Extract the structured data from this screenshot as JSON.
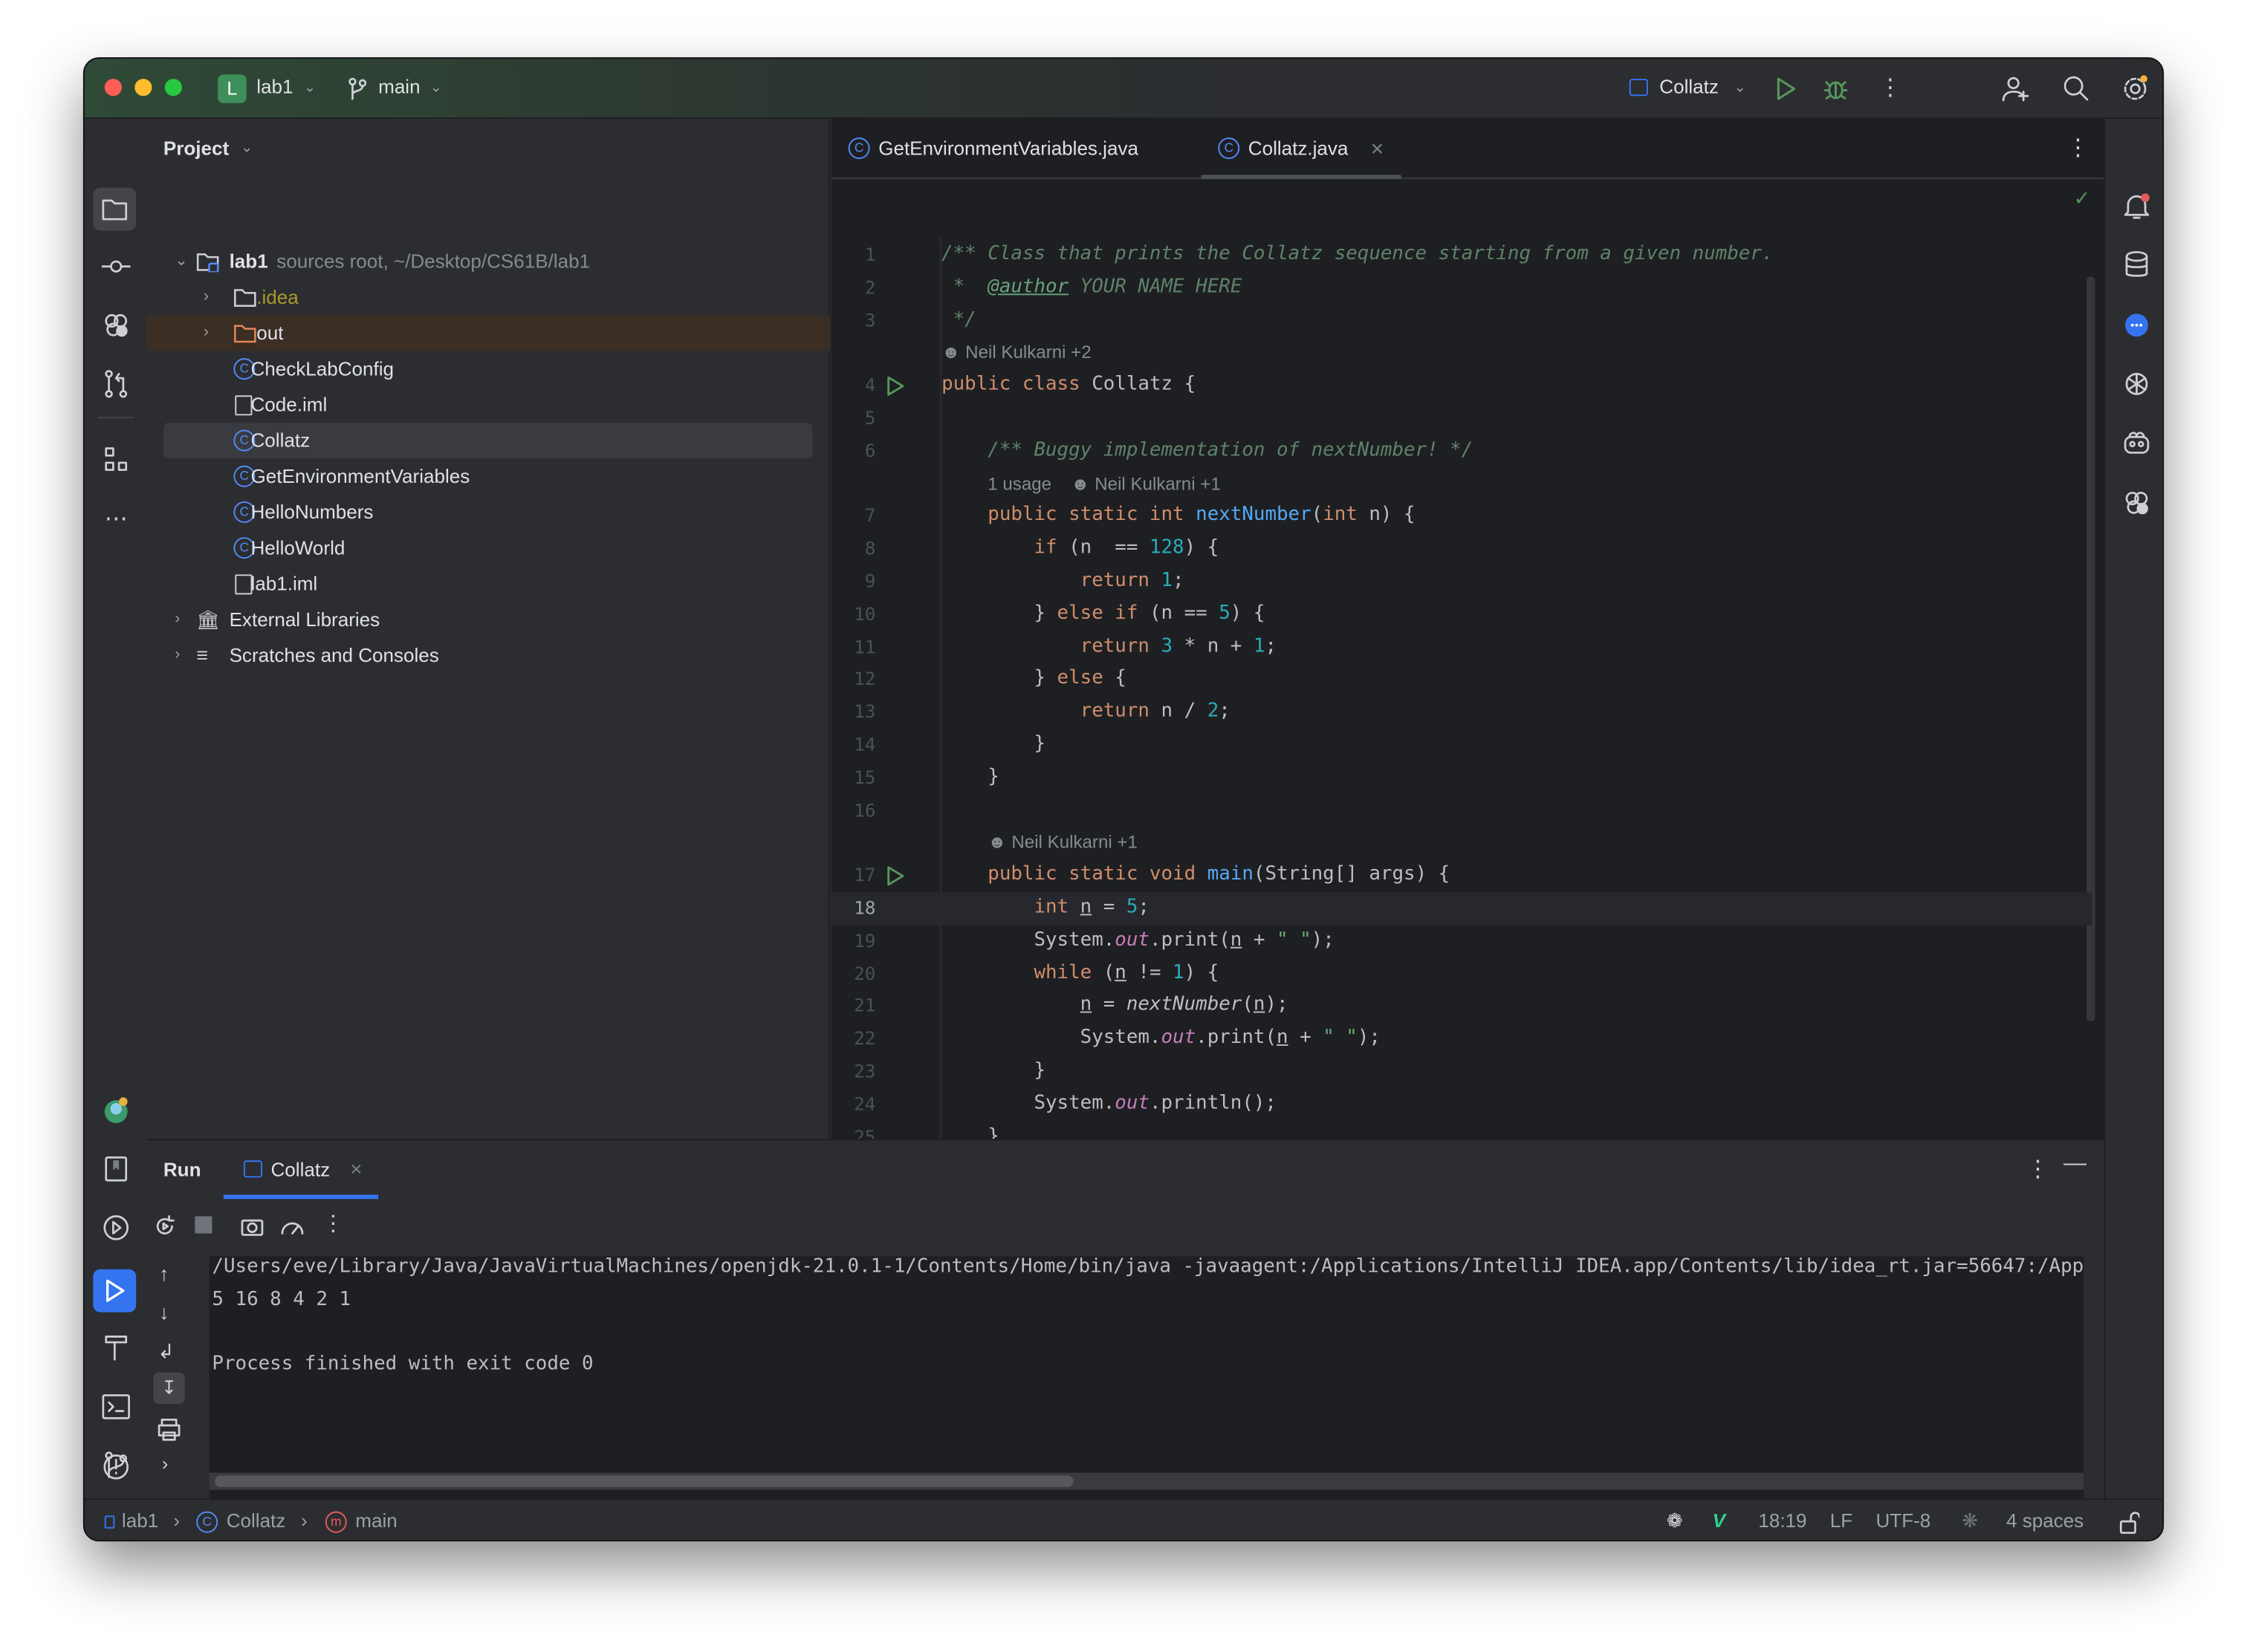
{
  "titlebar": {
    "project_badge": "L",
    "project": "lab1",
    "branch": "main",
    "run_config": "Collatz",
    "colors": {
      "project_badge": "#3F8F5A",
      "run": "#57965C"
    }
  },
  "project_panel": {
    "title": "Project",
    "items": [
      {
        "label": "lab1",
        "hint": "sources root,  ~/Desktop/CS61B/lab1",
        "icon": "module-folder-icon",
        "level": 0,
        "expanded": true
      },
      {
        "label": ".idea",
        "icon": "folder-icon",
        "level": 1,
        "collapsed": true,
        "color": "#A89A2A"
      },
      {
        "label": "out",
        "icon": "excluded-folder-icon",
        "level": 1,
        "collapsed": true,
        "highlight": "excluded"
      },
      {
        "label": "CheckLabConfig",
        "icon": "java-class-icon",
        "level": 1
      },
      {
        "label": "Code.iml",
        "icon": "iml-file-icon",
        "level": 1
      },
      {
        "label": "Collatz",
        "icon": "java-class-icon",
        "level": 1,
        "selected": true
      },
      {
        "label": "GetEnvironmentVariables",
        "icon": "java-class-icon",
        "level": 1
      },
      {
        "label": "HelloNumbers",
        "icon": "java-class-icon",
        "level": 1
      },
      {
        "label": "HelloWorld",
        "icon": "java-class-icon",
        "level": 1
      },
      {
        "label": "lab1.iml",
        "icon": "iml-file-icon",
        "level": 1
      },
      {
        "label": "External Libraries",
        "icon": "library-icon",
        "level": 0,
        "collapsed": true
      },
      {
        "label": "Scratches and Consoles",
        "icon": "scratches-icon",
        "level": 0,
        "collapsed": true
      }
    ]
  },
  "editor": {
    "tabs": [
      {
        "label": "GetEnvironmentVariables.java",
        "active": false
      },
      {
        "label": "Collatz.java",
        "active": true
      }
    ],
    "current_line": "18",
    "rows": [
      {
        "num": "1",
        "tokens": [
          [
            "cm",
            "/** Class that prints the Collatz sequence starting from a given number."
          ]
        ]
      },
      {
        "num": "2",
        "tokens": [
          [
            "cm",
            " *  "
          ],
          [
            "tag",
            "@author"
          ],
          [
            "cm",
            " YOUR NAME HERE"
          ]
        ]
      },
      {
        "num": "3",
        "tokens": [
          [
            "cm",
            " */"
          ]
        ]
      },
      {
        "inlay": "Neil Kulkarni +2",
        "indent": 0
      },
      {
        "num": "4",
        "run": true,
        "tokens": [
          [
            "kw",
            "public class "
          ],
          [
            "",
            "Collatz {"
          ]
        ]
      },
      {
        "num": "5",
        "tokens": []
      },
      {
        "num": "6",
        "tokens": [
          [
            "",
            "    "
          ],
          [
            "cm",
            "/** Buggy implementation of nextNumber! */"
          ]
        ]
      },
      {
        "inlay": "Neil Kulkarni +1",
        "usage": "1 usage",
        "indent": 4
      },
      {
        "num": "7",
        "tokens": [
          [
            "",
            "    "
          ],
          [
            "kw",
            "public static int "
          ],
          [
            "fn",
            "nextNumber"
          ],
          [
            "",
            "("
          ],
          [
            "kw",
            "int "
          ],
          [
            "",
            "n) {"
          ]
        ]
      },
      {
        "num": "8",
        "tokens": [
          [
            "",
            "        "
          ],
          [
            "kw",
            "if "
          ],
          [
            "",
            "(n  == "
          ],
          [
            "num",
            "128"
          ],
          [
            "",
            ") {"
          ]
        ]
      },
      {
        "num": "9",
        "tokens": [
          [
            "",
            "            "
          ],
          [
            "kw",
            "return "
          ],
          [
            "num",
            "1"
          ],
          [
            "",
            ";"
          ]
        ]
      },
      {
        "num": "10",
        "tokens": [
          [
            "",
            "        } "
          ],
          [
            "kw",
            "else if "
          ],
          [
            "",
            "(n == "
          ],
          [
            "num",
            "5"
          ],
          [
            "",
            ") {"
          ]
        ]
      },
      {
        "num": "11",
        "tokens": [
          [
            "",
            "            "
          ],
          [
            "kw",
            "return "
          ],
          [
            "num",
            "3"
          ],
          [
            "",
            " * n + "
          ],
          [
            "num",
            "1"
          ],
          [
            "",
            ";"
          ]
        ]
      },
      {
        "num": "12",
        "tokens": [
          [
            "",
            "        } "
          ],
          [
            "kw",
            "else "
          ],
          [
            "",
            "{"
          ]
        ]
      },
      {
        "num": "13",
        "tokens": [
          [
            "",
            "            "
          ],
          [
            "kw",
            "return "
          ],
          [
            "",
            "n / "
          ],
          [
            "num",
            "2"
          ],
          [
            "",
            ";"
          ]
        ]
      },
      {
        "num": "14",
        "tokens": [
          [
            "",
            "        }"
          ]
        ]
      },
      {
        "num": "15",
        "tokens": [
          [
            "",
            "    }"
          ]
        ]
      },
      {
        "num": "16",
        "tokens": []
      },
      {
        "inlay": "Neil Kulkarni +1",
        "indent": 4
      },
      {
        "num": "17",
        "run": true,
        "tokens": [
          [
            "",
            "    "
          ],
          [
            "kw",
            "public static void "
          ],
          [
            "fn",
            "main"
          ],
          [
            "",
            "(String[] args) {"
          ]
        ]
      },
      {
        "num": "18",
        "tokens": [
          [
            "",
            "        "
          ],
          [
            "kw",
            "int "
          ],
          [
            "var",
            "n"
          ],
          [
            "",
            " = "
          ],
          [
            "num",
            "5"
          ],
          [
            "",
            ";"
          ]
        ]
      },
      {
        "num": "19",
        "tokens": [
          [
            "",
            "        System."
          ],
          [
            "fld",
            "out"
          ],
          [
            "",
            ".print("
          ],
          [
            "var",
            "n"
          ],
          [
            "",
            " + "
          ],
          [
            "st",
            "\" \""
          ],
          [
            "",
            ");"
          ]
        ]
      },
      {
        "num": "20",
        "tokens": [
          [
            "",
            "        "
          ],
          [
            "kw",
            "while "
          ],
          [
            "",
            "("
          ],
          [
            "var",
            "n"
          ],
          [
            "",
            " != "
          ],
          [
            "num",
            "1"
          ],
          [
            "",
            ") {"
          ]
        ]
      },
      {
        "num": "21",
        "tokens": [
          [
            "",
            "            "
          ],
          [
            "var",
            "n"
          ],
          [
            "",
            " = "
          ],
          [
            "call",
            "nextNumber"
          ],
          [
            "",
            "("
          ],
          [
            "var",
            "n"
          ],
          [
            "",
            ");"
          ]
        ]
      },
      {
        "num": "22",
        "tokens": [
          [
            "",
            "            System."
          ],
          [
            "fld",
            "out"
          ],
          [
            "",
            ".print("
          ],
          [
            "var",
            "n"
          ],
          [
            "",
            " + "
          ],
          [
            "st",
            "\" \""
          ],
          [
            "",
            ");"
          ]
        ]
      },
      {
        "num": "23",
        "tokens": [
          [
            "",
            "        }"
          ]
        ]
      },
      {
        "num": "24",
        "tokens": [
          [
            "",
            "        System."
          ],
          [
            "fld",
            "out"
          ],
          [
            "",
            ".println();"
          ]
        ]
      },
      {
        "num": "25",
        "tokens": [
          [
            "",
            "    }"
          ]
        ]
      },
      {
        "num": "26",
        "tokens": [
          [
            "",
            "}"
          ]
        ]
      }
    ]
  },
  "run_panel": {
    "title": "Run",
    "tab": "Collatz",
    "output": [
      "/Users/eve/Library/Java/JavaVirtualMachines/openjdk-21.0.1-1/Contents/Home/bin/java -javaagent:/Applications/IntelliJ IDEA.app/Contents/lib/idea_rt.jar=56647:/App",
      "5 16 8 4 2 1",
      "",
      "Process finished with exit code 0"
    ]
  },
  "statusbar": {
    "breadcrumb": [
      "lab1",
      "Collatz",
      "main"
    ],
    "position": "18:19",
    "line_sep": "LF",
    "encoding": "UTF-8",
    "indent": "4 spaces"
  },
  "colors": {
    "accent": "#3574F0",
    "keyword": "#CF8E6D",
    "comment": "#5F826B",
    "number": "#2AACB8",
    "function": "#56A8F5"
  }
}
